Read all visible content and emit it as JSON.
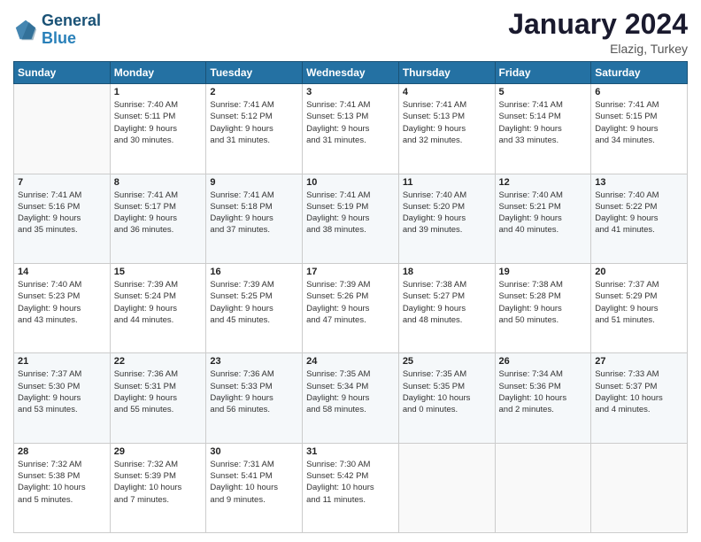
{
  "logo": {
    "line1": "General",
    "line2": "Blue"
  },
  "header": {
    "month_year": "January 2024",
    "location": "Elazig, Turkey"
  },
  "weekdays": [
    "Sunday",
    "Monday",
    "Tuesday",
    "Wednesday",
    "Thursday",
    "Friday",
    "Saturday"
  ],
  "weeks": [
    [
      {
        "day": "",
        "info": ""
      },
      {
        "day": "1",
        "info": "Sunrise: 7:40 AM\nSunset: 5:11 PM\nDaylight: 9 hours\nand 30 minutes."
      },
      {
        "day": "2",
        "info": "Sunrise: 7:41 AM\nSunset: 5:12 PM\nDaylight: 9 hours\nand 31 minutes."
      },
      {
        "day": "3",
        "info": "Sunrise: 7:41 AM\nSunset: 5:13 PM\nDaylight: 9 hours\nand 31 minutes."
      },
      {
        "day": "4",
        "info": "Sunrise: 7:41 AM\nSunset: 5:13 PM\nDaylight: 9 hours\nand 32 minutes."
      },
      {
        "day": "5",
        "info": "Sunrise: 7:41 AM\nSunset: 5:14 PM\nDaylight: 9 hours\nand 33 minutes."
      },
      {
        "day": "6",
        "info": "Sunrise: 7:41 AM\nSunset: 5:15 PM\nDaylight: 9 hours\nand 34 minutes."
      }
    ],
    [
      {
        "day": "7",
        "info": "Sunrise: 7:41 AM\nSunset: 5:16 PM\nDaylight: 9 hours\nand 35 minutes."
      },
      {
        "day": "8",
        "info": "Sunrise: 7:41 AM\nSunset: 5:17 PM\nDaylight: 9 hours\nand 36 minutes."
      },
      {
        "day": "9",
        "info": "Sunrise: 7:41 AM\nSunset: 5:18 PM\nDaylight: 9 hours\nand 37 minutes."
      },
      {
        "day": "10",
        "info": "Sunrise: 7:41 AM\nSunset: 5:19 PM\nDaylight: 9 hours\nand 38 minutes."
      },
      {
        "day": "11",
        "info": "Sunrise: 7:40 AM\nSunset: 5:20 PM\nDaylight: 9 hours\nand 39 minutes."
      },
      {
        "day": "12",
        "info": "Sunrise: 7:40 AM\nSunset: 5:21 PM\nDaylight: 9 hours\nand 40 minutes."
      },
      {
        "day": "13",
        "info": "Sunrise: 7:40 AM\nSunset: 5:22 PM\nDaylight: 9 hours\nand 41 minutes."
      }
    ],
    [
      {
        "day": "14",
        "info": "Sunrise: 7:40 AM\nSunset: 5:23 PM\nDaylight: 9 hours\nand 43 minutes."
      },
      {
        "day": "15",
        "info": "Sunrise: 7:39 AM\nSunset: 5:24 PM\nDaylight: 9 hours\nand 44 minutes."
      },
      {
        "day": "16",
        "info": "Sunrise: 7:39 AM\nSunset: 5:25 PM\nDaylight: 9 hours\nand 45 minutes."
      },
      {
        "day": "17",
        "info": "Sunrise: 7:39 AM\nSunset: 5:26 PM\nDaylight: 9 hours\nand 47 minutes."
      },
      {
        "day": "18",
        "info": "Sunrise: 7:38 AM\nSunset: 5:27 PM\nDaylight: 9 hours\nand 48 minutes."
      },
      {
        "day": "19",
        "info": "Sunrise: 7:38 AM\nSunset: 5:28 PM\nDaylight: 9 hours\nand 50 minutes."
      },
      {
        "day": "20",
        "info": "Sunrise: 7:37 AM\nSunset: 5:29 PM\nDaylight: 9 hours\nand 51 minutes."
      }
    ],
    [
      {
        "day": "21",
        "info": "Sunrise: 7:37 AM\nSunset: 5:30 PM\nDaylight: 9 hours\nand 53 minutes."
      },
      {
        "day": "22",
        "info": "Sunrise: 7:36 AM\nSunset: 5:31 PM\nDaylight: 9 hours\nand 55 minutes."
      },
      {
        "day": "23",
        "info": "Sunrise: 7:36 AM\nSunset: 5:33 PM\nDaylight: 9 hours\nand 56 minutes."
      },
      {
        "day": "24",
        "info": "Sunrise: 7:35 AM\nSunset: 5:34 PM\nDaylight: 9 hours\nand 58 minutes."
      },
      {
        "day": "25",
        "info": "Sunrise: 7:35 AM\nSunset: 5:35 PM\nDaylight: 10 hours\nand 0 minutes."
      },
      {
        "day": "26",
        "info": "Sunrise: 7:34 AM\nSunset: 5:36 PM\nDaylight: 10 hours\nand 2 minutes."
      },
      {
        "day": "27",
        "info": "Sunrise: 7:33 AM\nSunset: 5:37 PM\nDaylight: 10 hours\nand 4 minutes."
      }
    ],
    [
      {
        "day": "28",
        "info": "Sunrise: 7:32 AM\nSunset: 5:38 PM\nDaylight: 10 hours\nand 5 minutes."
      },
      {
        "day": "29",
        "info": "Sunrise: 7:32 AM\nSunset: 5:39 PM\nDaylight: 10 hours\nand 7 minutes."
      },
      {
        "day": "30",
        "info": "Sunrise: 7:31 AM\nSunset: 5:41 PM\nDaylight: 10 hours\nand 9 minutes."
      },
      {
        "day": "31",
        "info": "Sunrise: 7:30 AM\nSunset: 5:42 PM\nDaylight: 10 hours\nand 11 minutes."
      },
      {
        "day": "",
        "info": ""
      },
      {
        "day": "",
        "info": ""
      },
      {
        "day": "",
        "info": ""
      }
    ]
  ]
}
